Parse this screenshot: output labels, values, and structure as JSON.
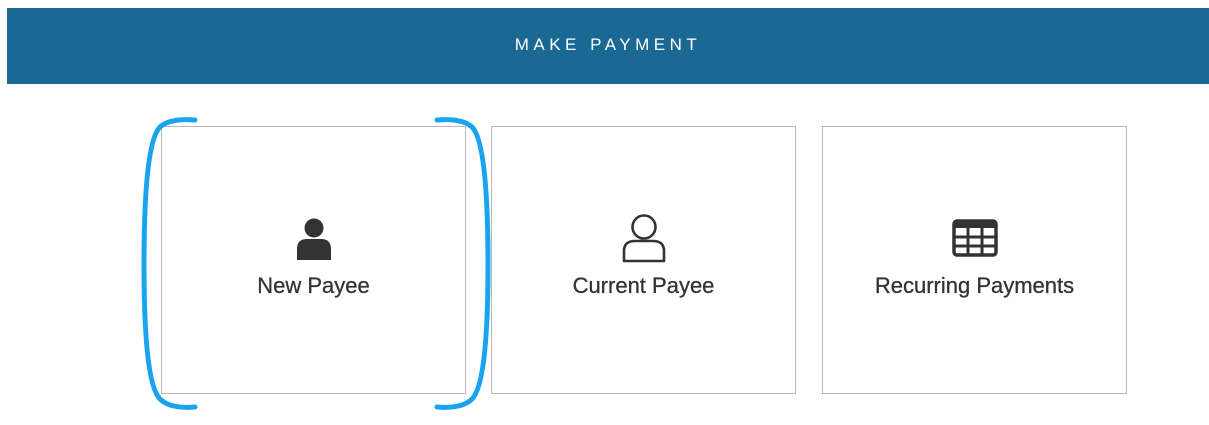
{
  "header": {
    "title": "MAKE PAYMENT",
    "background_color": "#1a6994"
  },
  "options": [
    {
      "label": "New Payee",
      "icon": "user-filled-icon"
    },
    {
      "label": "Current Payee",
      "icon": "user-outline-icon"
    },
    {
      "label": "Recurring Payments",
      "icon": "table-grid-icon"
    }
  ],
  "highlight": {
    "target": "New Payee",
    "color": "#1aa3f0"
  }
}
